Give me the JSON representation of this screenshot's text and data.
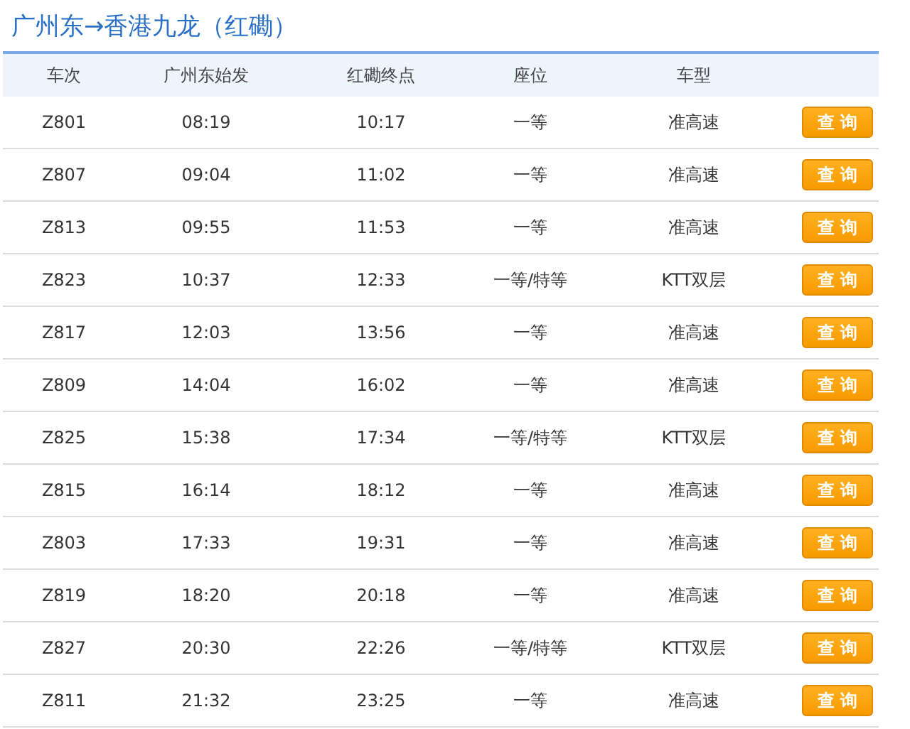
{
  "title": "广州东→香港九龙（红磡）",
  "columns": [
    "车次",
    "广州东始发",
    "红磡终点",
    "座位",
    "车型",
    ""
  ],
  "rows": [
    {
      "train": "Z801",
      "depart": "08:19",
      "arrive": "10:17",
      "seat": "一等",
      "type": "准高速",
      "action": "查 询"
    },
    {
      "train": "Z807",
      "depart": "09:04",
      "arrive": "11:02",
      "seat": "一等",
      "type": "准高速",
      "action": "查 询"
    },
    {
      "train": "Z813",
      "depart": "09:55",
      "arrive": "11:53",
      "seat": "一等",
      "type": "准高速",
      "action": "查 询"
    },
    {
      "train": "Z823",
      "depart": "10:37",
      "arrive": "12:33",
      "seat": "一等/特等",
      "type": "KTT双层",
      "action": "查 询"
    },
    {
      "train": "Z817",
      "depart": "12:03",
      "arrive": "13:56",
      "seat": "一等",
      "type": "准高速",
      "action": "查 询"
    },
    {
      "train": "Z809",
      "depart": "14:04",
      "arrive": "16:02",
      "seat": "一等",
      "type": "准高速",
      "action": "查 询"
    },
    {
      "train": "Z825",
      "depart": "15:38",
      "arrive": "17:34",
      "seat": "一等/特等",
      "type": "KTT双层",
      "action": "查 询"
    },
    {
      "train": "Z815",
      "depart": "16:14",
      "arrive": "18:12",
      "seat": "一等",
      "type": "准高速",
      "action": "查 询"
    },
    {
      "train": "Z803",
      "depart": "17:33",
      "arrive": "19:31",
      "seat": "一等",
      "type": "准高速",
      "action": "查 询"
    },
    {
      "train": "Z819",
      "depart": "18:20",
      "arrive": "20:18",
      "seat": "一等",
      "type": "准高速",
      "action": "查 询"
    },
    {
      "train": "Z827",
      "depart": "20:30",
      "arrive": "22:26",
      "seat": "一等/特等",
      "type": "KTT双层",
      "action": "查 询"
    },
    {
      "train": "Z811",
      "depart": "21:32",
      "arrive": "23:25",
      "seat": "一等",
      "type": "准高速",
      "action": "查 询"
    }
  ]
}
